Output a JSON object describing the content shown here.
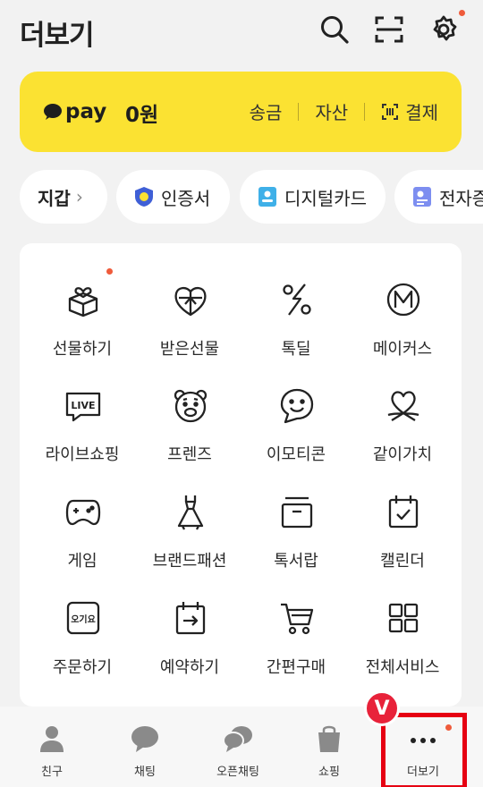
{
  "header": {
    "title": "더보기",
    "icons": [
      "search-icon",
      "scan-icon",
      "settings-icon"
    ]
  },
  "pay": {
    "brand": "pay",
    "amount": "0원",
    "actions": [
      "송금",
      "자산",
      "결제"
    ]
  },
  "wallet_chips": [
    {
      "label": "지갑",
      "icon": "chevron-right-icon"
    },
    {
      "label": "인증서",
      "icon": "shield-icon"
    },
    {
      "label": "디지털카드",
      "icon": "id-card-icon"
    },
    {
      "label": "전자증",
      "icon": "document-icon"
    }
  ],
  "services": [
    {
      "label": "선물하기",
      "icon": "gift-box-icon",
      "new": true
    },
    {
      "label": "받은선물",
      "icon": "heart-gift-icon"
    },
    {
      "label": "톡딜",
      "icon": "lightning-percent-icon"
    },
    {
      "label": "메이커스",
      "icon": "makers-m-icon"
    },
    {
      "label": "라이브쇼핑",
      "icon": "live-icon"
    },
    {
      "label": "프렌즈",
      "icon": "bear-face-icon"
    },
    {
      "label": "이모티콘",
      "icon": "emoticon-icon"
    },
    {
      "label": "같이가치",
      "icon": "hands-heart-icon"
    },
    {
      "label": "게임",
      "icon": "gamepad-icon"
    },
    {
      "label": "브랜드패션",
      "icon": "dress-icon"
    },
    {
      "label": "톡서랍",
      "icon": "drawer-icon"
    },
    {
      "label": "캘린더",
      "icon": "calendar-icon"
    },
    {
      "label": "주문하기",
      "icon": "order-icon",
      "icon_text": "오기요"
    },
    {
      "label": "예약하기",
      "icon": "reservation-icon"
    },
    {
      "label": "간편구매",
      "icon": "cart-icon"
    },
    {
      "label": "전체서비스",
      "icon": "grid-icon"
    }
  ],
  "tabs": [
    {
      "label": "친구",
      "icon": "person-icon"
    },
    {
      "label": "채팅",
      "icon": "chat-icon"
    },
    {
      "label": "오픈채팅",
      "icon": "open-chat-icon"
    },
    {
      "label": "쇼핑",
      "icon": "shopping-bag-icon"
    },
    {
      "label": "더보기",
      "icon": "more-dots-icon",
      "active": true
    }
  ],
  "annotation": {
    "badge": "V"
  },
  "colors": {
    "pay_yellow": "#fbe232",
    "background": "#f2f2f2",
    "notify_dot": "#ef5b3b",
    "highlight_red": "#e60012"
  }
}
